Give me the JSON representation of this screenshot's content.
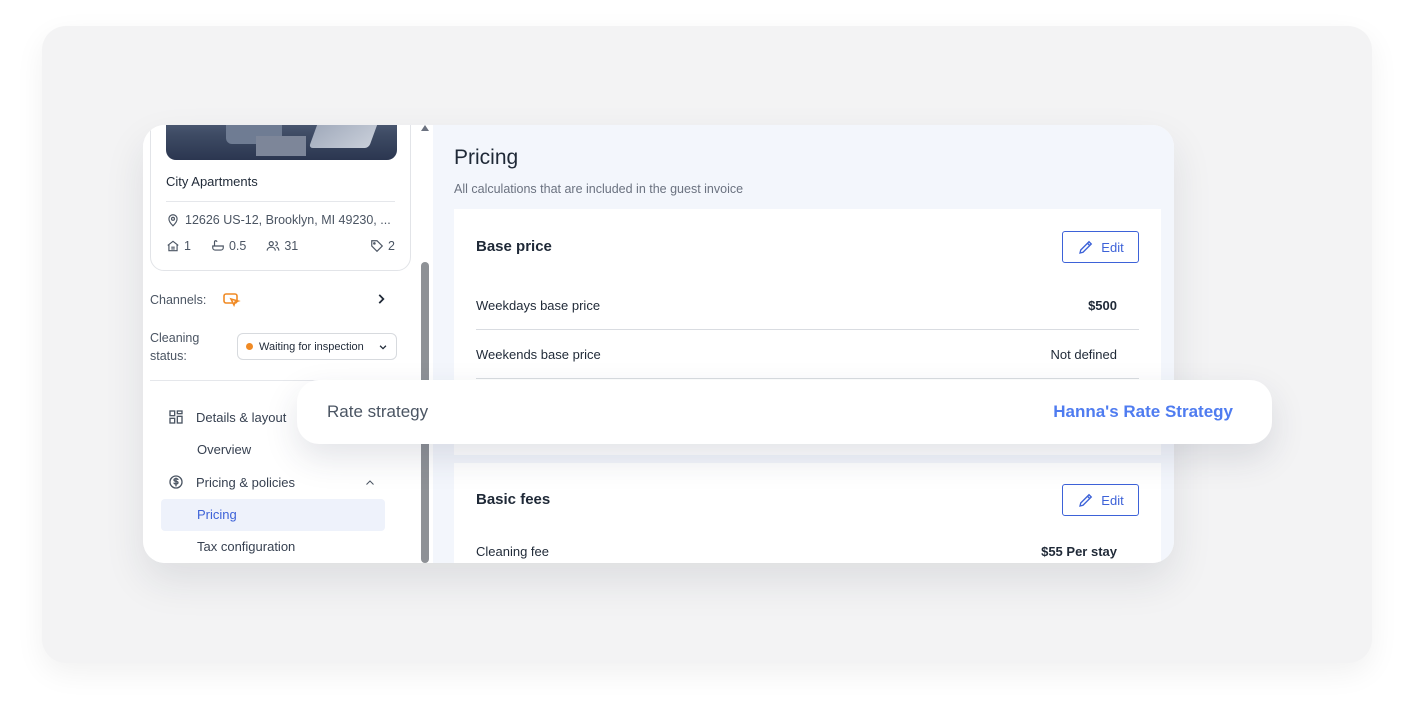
{
  "property": {
    "name": "City Apartments",
    "address": "12626 US-12, Brooklyn, MI 49230, ...",
    "stats": {
      "bedrooms": "1",
      "bathrooms": "0.5",
      "guests": "31",
      "tags": "2"
    }
  },
  "channels": {
    "label": "Channels:"
  },
  "cleaning": {
    "label": "Cleaning status:",
    "status": "Waiting for inspection",
    "status_color": "#f08a24"
  },
  "nav": {
    "details": "Details & layout",
    "overview": "Overview",
    "pricing_policies": "Pricing & policies",
    "pricing": "Pricing",
    "tax": "Tax configuration"
  },
  "page": {
    "title": "Pricing",
    "subtitle": "All calculations that are included in the guest invoice"
  },
  "base_price": {
    "title": "Base price",
    "edit_label": "Edit",
    "rows": [
      {
        "label": "Weekdays base price",
        "value": "$500"
      },
      {
        "label": "Weekends base price",
        "value": "Not defined"
      }
    ]
  },
  "basic_fees": {
    "title": "Basic fees",
    "edit_label": "Edit",
    "rows": [
      {
        "label": "Cleaning fee",
        "value": "$55 Per stay"
      }
    ]
  },
  "rate_strategy": {
    "label": "Rate strategy",
    "value": "Hanna's Rate Strategy"
  },
  "colors": {
    "accent": "#3d62d8",
    "rate_value": "#4f7cf0",
    "panel_bg": "#f3f6fc"
  }
}
